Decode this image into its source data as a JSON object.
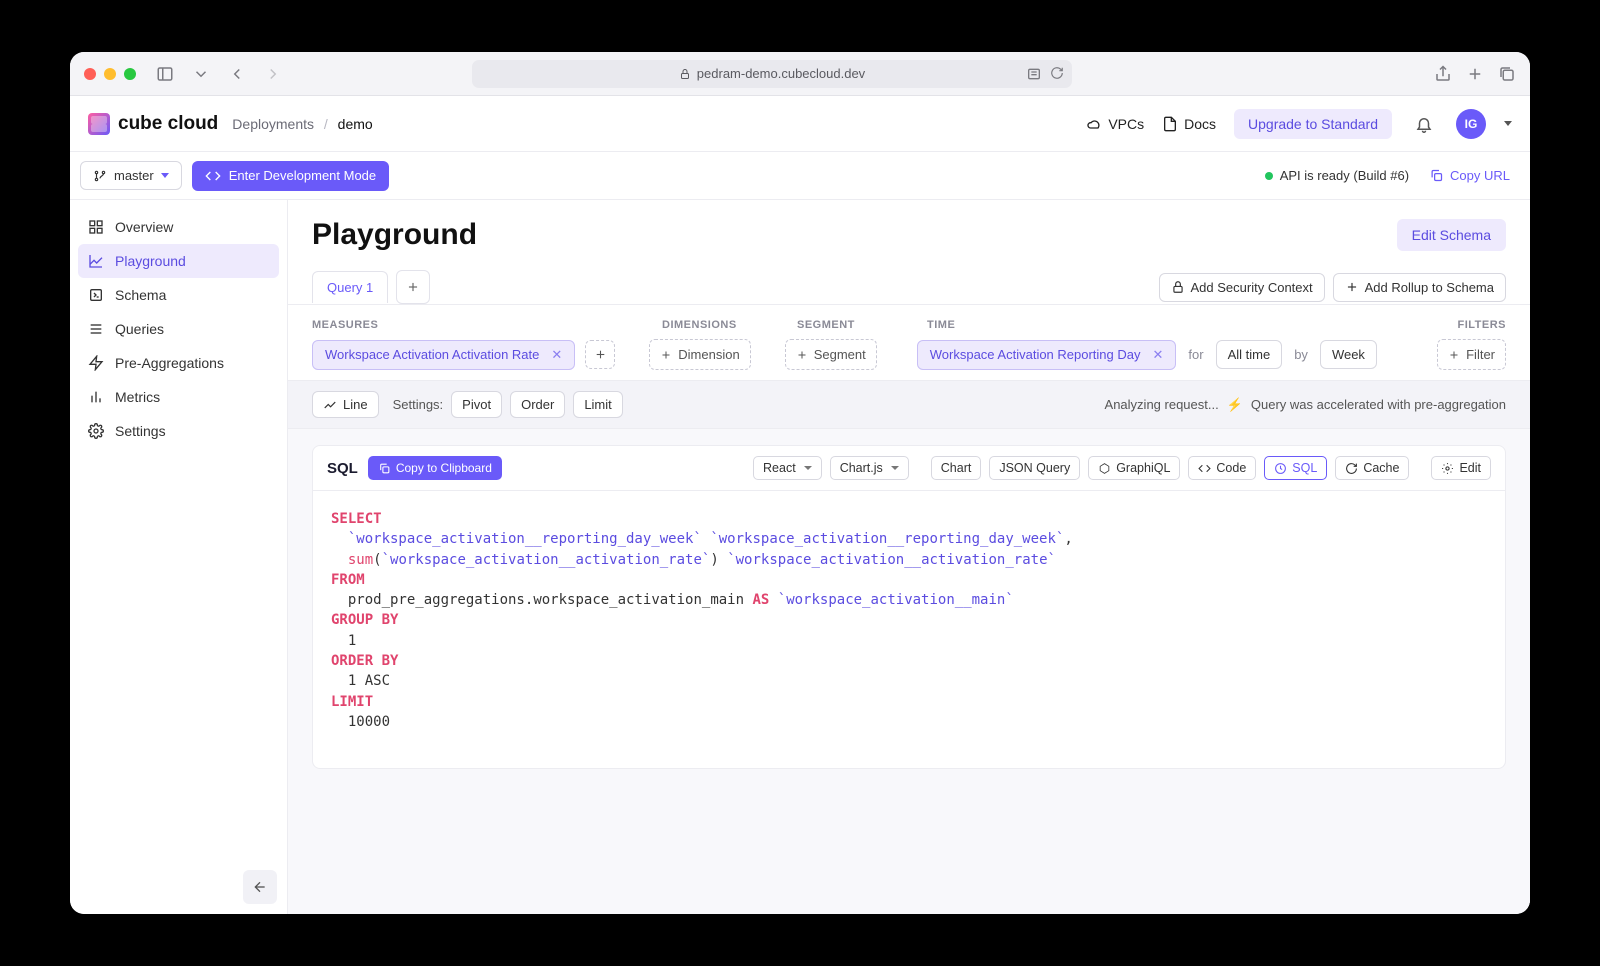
{
  "browser": {
    "url": "pedram-demo.cubecloud.dev"
  },
  "logo": "cube cloud",
  "breadcrumb": {
    "root": "Deployments",
    "current": "demo"
  },
  "header": {
    "vpcs": "VPCs",
    "docs": "Docs",
    "upgrade": "Upgrade to Standard",
    "avatar": "IG"
  },
  "subheader": {
    "branch": "master",
    "dev_mode": "Enter Development Mode",
    "api_status": "API is ready (Build #6)",
    "copy_url": "Copy URL"
  },
  "sidebar": {
    "items": [
      {
        "label": "Overview"
      },
      {
        "label": "Playground"
      },
      {
        "label": "Schema"
      },
      {
        "label": "Queries"
      },
      {
        "label": "Pre-Aggregations"
      },
      {
        "label": "Metrics"
      },
      {
        "label": "Settings"
      }
    ]
  },
  "page": {
    "title": "Playground",
    "edit_schema": "Edit Schema"
  },
  "tabs": {
    "query1": "Query 1",
    "add_security": "Add Security Context",
    "add_rollup": "Add Rollup to Schema"
  },
  "labels": {
    "measures": "MEASURES",
    "dimensions": "DIMENSIONS",
    "segment": "SEGMENT",
    "time": "TIME",
    "filters": "FILTERS"
  },
  "query": {
    "measure_chip": "Workspace Activation Activation Rate",
    "dimension_btn": "Dimension",
    "segment_btn": "Segment",
    "time_chip": "Workspace Activation Reporting Day",
    "for": "for",
    "all_time": "All time",
    "by": "by",
    "week": "Week",
    "filter_btn": "Filter"
  },
  "viz": {
    "line": "Line",
    "settings": "Settings:",
    "pivot": "Pivot",
    "order": "Order",
    "limit": "Limit",
    "analyzing": "Analyzing request...",
    "accel": "Query was accelerated with pre-aggregation"
  },
  "sql": {
    "title": "SQL",
    "copy": "Copy to Clipboard",
    "react": "React",
    "chartjs": "Chart.js",
    "chart": "Chart",
    "json_query": "JSON Query",
    "graphiql": "GraphiQL",
    "code": "Code",
    "sql_btn": "SQL",
    "cache": "Cache",
    "edit": "Edit",
    "tokens": {
      "select": "SELECT",
      "col1": "`workspace_activation__reporting_day_week`",
      "col1a": "`workspace_activation__reporting_day_week`",
      "sum": "sum",
      "arg": "`workspace_activation__activation_rate`",
      "alias2": "`workspace_activation__activation_rate`",
      "from": "FROM",
      "table": "prod_pre_aggregations",
      "table2": "workspace_activation_main",
      "as": "AS",
      "alias3": "`workspace_activation__main`",
      "group_by": "GROUP BY",
      "one": "1",
      "order_by": "ORDER BY",
      "one_asc": "1 ASC",
      "limit": "LIMIT",
      "limit_n": "10000"
    }
  }
}
